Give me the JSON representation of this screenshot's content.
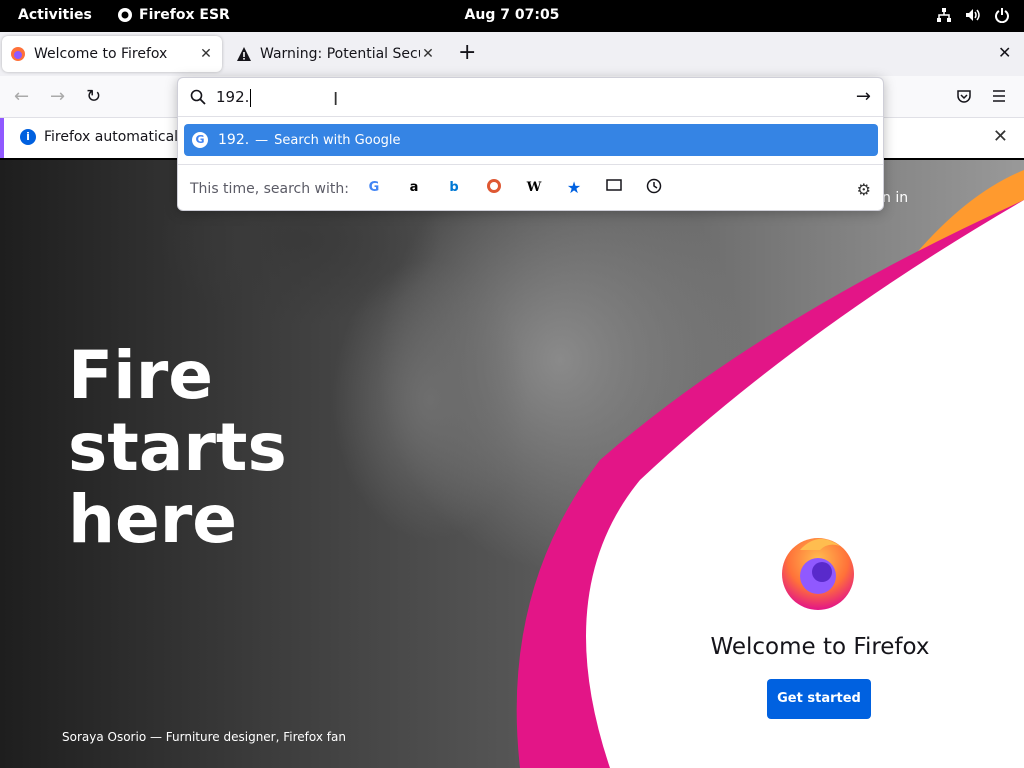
{
  "topbar": {
    "activities": "Activities",
    "app_name": "Firefox ESR",
    "clock": "Aug 7  07:05",
    "icons": [
      "network-icon",
      "volume-icon",
      "power-icon"
    ]
  },
  "tabs": [
    {
      "label": "Welcome to Firefox",
      "icon": "firefox-icon",
      "active": true
    },
    {
      "label": "Warning: Potential Securi",
      "icon": "warning-icon",
      "active": false
    }
  ],
  "urlbar": {
    "value": "192.",
    "suggestion_query": "192.",
    "suggestion_action": "Search with Google",
    "oneoff_label": "This time, search with:",
    "engines": [
      "google-icon",
      "amazon-icon",
      "bing-icon",
      "duckduckgo-icon",
      "wikipedia-icon",
      "bookmarks-icon",
      "tabs-icon",
      "history-icon"
    ]
  },
  "notice": {
    "text": "Firefox automatically"
  },
  "page": {
    "headline_line1": "Fire",
    "headline_line2": "starts",
    "headline_line3": "here",
    "caption": "Soraya Osorio — Furniture designer, Firefox fan",
    "signin_fragment": "n in",
    "welcome_title": "Welcome to Firefox",
    "cta": "Get started"
  },
  "colors": {
    "accent": "#0061e0",
    "suggestion_highlight": "#3584e4",
    "pink": "#e31587",
    "orange": "#ff9a2e"
  }
}
